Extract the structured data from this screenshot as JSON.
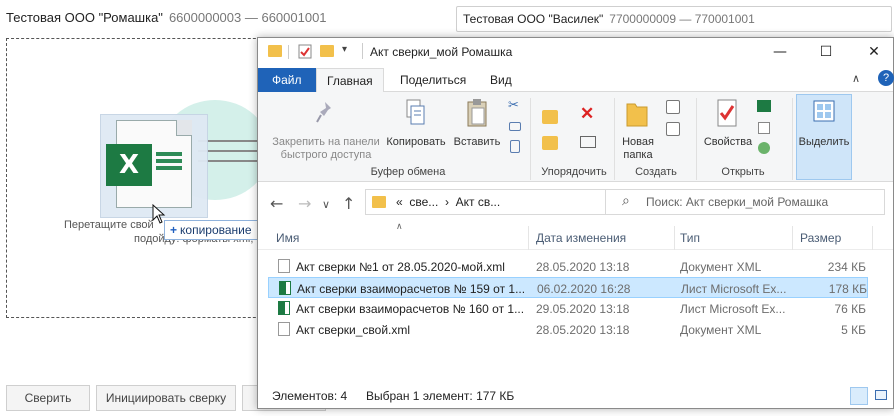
{
  "app": {
    "org_left_name": "Тестовая ООО \"Ромашка\"",
    "org_left_req": "6600000003 — 660001001",
    "org_right_name": "Тестовая ООО \"Василек\"",
    "org_right_req": "7700000009 — 770001001",
    "drop_hint_1": "Перетащите свой",
    "drop_hint_2": "подойду: форматы xml,",
    "copy_tooltip": "копирование",
    "copy_plus": "+",
    "buttons": {
      "compare": "Сверить",
      "initiate": "Инициировать сверку"
    }
  },
  "explorer": {
    "title": "Акт сверки_мой Ромашка",
    "tabs": [
      "Файл",
      "Главная",
      "Поделиться",
      "Вид"
    ],
    "ribbon": {
      "pin": "Закрепить на панели быстрого доступа",
      "copy": "Копировать",
      "paste": "Вставить",
      "new_folder": "Новая папка",
      "properties": "Свойства",
      "select": "Выделить",
      "groups": [
        "Буфер обмена",
        "Упорядочить",
        "Создать",
        "Открыть"
      ]
    },
    "address": {
      "prefix": "«",
      "seg1": "све...",
      "seg2": "Акт св..."
    },
    "search_placeholder": "Поиск: Акт сверки_мой Ромашка",
    "columns": [
      "Имя",
      "Дата изменения",
      "Тип",
      "Размер"
    ],
    "files": [
      {
        "name": "Акт сверки №1 от 28.05.2020-мой.xml",
        "date": "28.05.2020 13:18",
        "type": "Документ XML",
        "size": "234 КБ",
        "icon": "xml-file-icon",
        "selected": false
      },
      {
        "name": "Акт сверки взаиморасчетов № 159 от 1...",
        "date": "06.02.2020 16:28",
        "type": "Лист Microsoft Ex...",
        "size": "178 КБ",
        "icon": "excel-file-icon",
        "selected": true
      },
      {
        "name": "Акт сверки взаиморасчетов № 160 от 1...",
        "date": "29.05.2020 13:18",
        "type": "Лист Microsoft Ex...",
        "size": "76 КБ",
        "icon": "excel-file-icon",
        "selected": false
      },
      {
        "name": "Акт сверки_свой.xml",
        "date": "28.05.2020 13:18",
        "type": "Документ XML",
        "size": "5 КБ",
        "icon": "xml-file-icon",
        "selected": false
      }
    ],
    "status": {
      "count": "Элементов: 4",
      "selected": "Выбран 1 элемент: 177 КБ"
    }
  },
  "colors": {
    "accent": "#1f63b8",
    "selection": "#cce8ff",
    "excel": "#1d7a43",
    "folder": "#f2c04b"
  }
}
